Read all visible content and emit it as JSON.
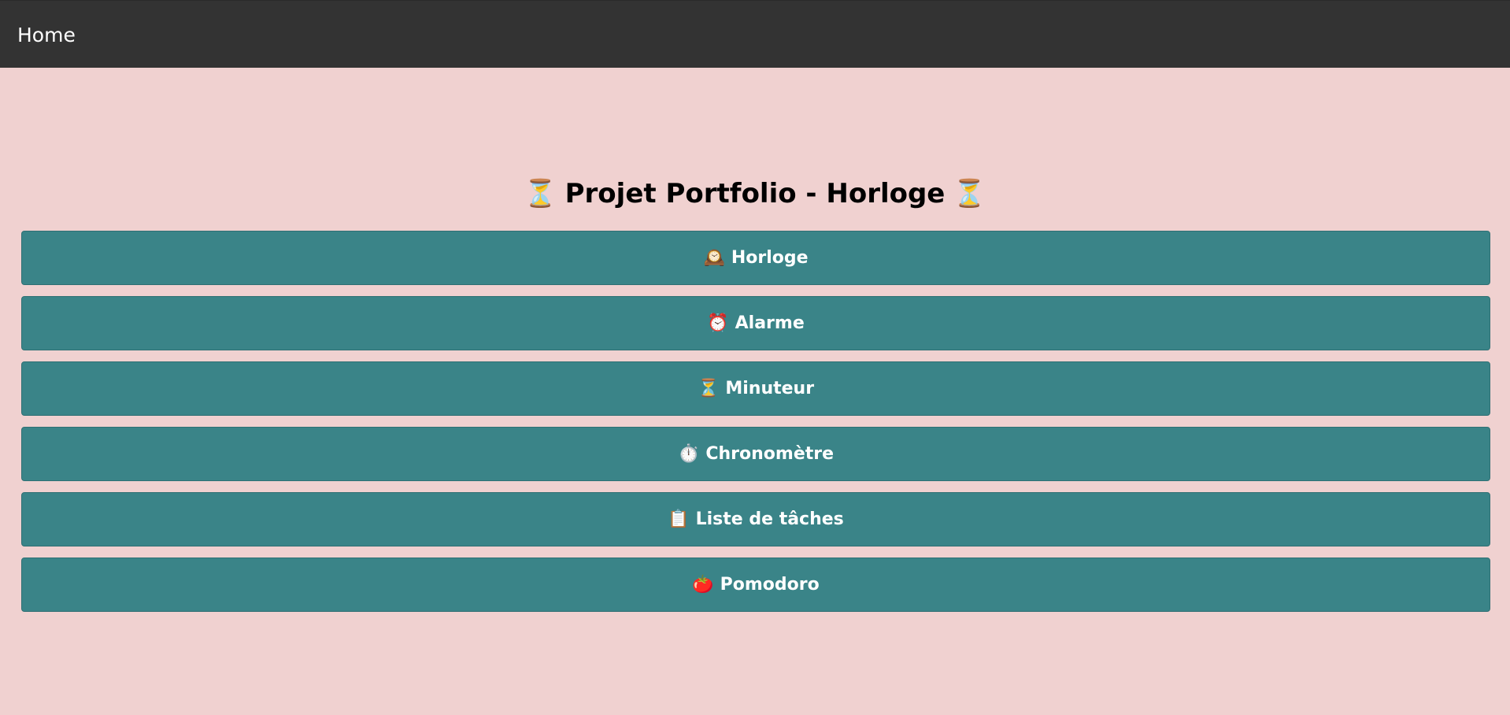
{
  "nav": {
    "home_label": "Home"
  },
  "page": {
    "title_icon": "⏳",
    "title": "Projet Portfolio - Horloge",
    "title_icon_end": "⏳"
  },
  "menu": {
    "items": [
      {
        "icon": "🕰️",
        "icon_name": "mantelpiece-clock-icon",
        "label": "Horloge"
      },
      {
        "icon": "⏰",
        "icon_name": "alarm-clock-icon",
        "label": "Alarme"
      },
      {
        "icon": "⏳",
        "icon_name": "hourglass-icon",
        "label": "Minuteur"
      },
      {
        "icon": "⏱️",
        "icon_name": "stopwatch-icon",
        "label": "Chronomètre"
      },
      {
        "icon": "📋",
        "icon_name": "clipboard-icon",
        "label": "Liste de tâches"
      },
      {
        "icon": "🍅",
        "icon_name": "tomato-icon",
        "label": "Pomodoro"
      }
    ]
  },
  "colors": {
    "background": "#f0d1d0",
    "topbar": "#333333",
    "button": "#3a8488",
    "button_text": "#ffffff"
  }
}
